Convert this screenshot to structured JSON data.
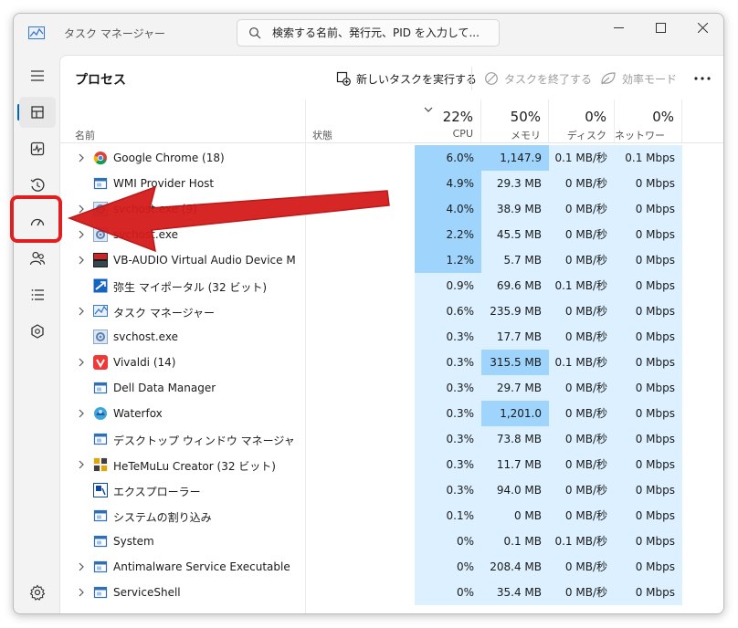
{
  "window": {
    "title": "タスク マネージャー",
    "search_placeholder": "検索する名前、発行元、PID を入力して..."
  },
  "nav": [
    {
      "id": "menu",
      "icon": "hamburger-icon"
    },
    {
      "id": "processes",
      "icon": "processes-icon",
      "active": true
    },
    {
      "id": "performance",
      "icon": "performance-icon"
    },
    {
      "id": "app-history",
      "icon": "history-icon"
    },
    {
      "id": "startup",
      "icon": "startup-speedometer-icon",
      "highlighted": true
    },
    {
      "id": "users",
      "icon": "users-icon"
    },
    {
      "id": "details",
      "icon": "details-list-icon"
    },
    {
      "id": "services",
      "icon": "services-puzzle-icon"
    },
    {
      "id": "settings",
      "icon": "gear-icon"
    }
  ],
  "page": {
    "title": "プロセス",
    "run_new_task": "新しいタスクを実行する",
    "end_task": "タスクを終了する",
    "efficiency_mode": "効率モード"
  },
  "columns": {
    "name": "名前",
    "status": "状態",
    "cpu": {
      "pct": "22%",
      "label": "CPU"
    },
    "memory": {
      "pct": "50%",
      "label": "メモリ"
    },
    "disk": {
      "pct": "0%",
      "label": "ディスク"
    },
    "network": {
      "pct": "0%",
      "label": "ネットワーク"
    }
  },
  "processes": [
    {
      "name": "Google Chrome (18)",
      "expandable": true,
      "icon": "chrome-icon",
      "cpu": "6.0%",
      "memory": "1,147.9 MB",
      "disk": "0.1 MB/秒",
      "network": "0.1 Mbps"
    },
    {
      "name": "WMI Provider Host",
      "expandable": false,
      "icon": "window-icon",
      "cpu": "4.9%",
      "memory": "29.3 MB",
      "disk": "0 MB/秒",
      "network": "0 Mbps"
    },
    {
      "name": "svchost.exe (9)",
      "expandable": true,
      "icon": "gear-app-icon",
      "cpu": "4.0%",
      "memory": "38.9 MB",
      "disk": "0 MB/秒",
      "network": "0 Mbps"
    },
    {
      "name": "svchost.exe",
      "expandable": true,
      "icon": "gear-app-icon",
      "cpu": "2.2%",
      "memory": "45.5 MB",
      "disk": "0 MB/秒",
      "network": "0 Mbps"
    },
    {
      "name": "VB-AUDIO Virtual Audio Device Mixi...",
      "expandable": true,
      "icon": "vb-audio-icon",
      "cpu": "1.2%",
      "memory": "5.7 MB",
      "disk": "0 MB/秒",
      "network": "0 Mbps"
    },
    {
      "name": "弥生 マイポータル (32 ビット)",
      "expandable": false,
      "icon": "yayoi-icon",
      "cpu": "0.9%",
      "memory": "69.6 MB",
      "disk": "0.1 MB/秒",
      "network": "0 Mbps"
    },
    {
      "name": "タスク マネージャー",
      "expandable": true,
      "icon": "task-manager-icon",
      "cpu": "0.6%",
      "memory": "235.9 MB",
      "disk": "0 MB/秒",
      "network": "0 Mbps"
    },
    {
      "name": "svchost.exe",
      "expandable": false,
      "icon": "gear-app-icon",
      "cpu": "0.3%",
      "memory": "17.7 MB",
      "disk": "0 MB/秒",
      "network": "0 Mbps"
    },
    {
      "name": "Vivaldi (14)",
      "expandable": true,
      "icon": "vivaldi-icon",
      "cpu": "0.3%",
      "memory": "315.5 MB",
      "disk": "0.1 MB/秒",
      "network": "0 Mbps"
    },
    {
      "name": "Dell Data Manager",
      "expandable": false,
      "icon": "window-icon",
      "cpu": "0.3%",
      "memory": "29.7 MB",
      "disk": "0 MB/秒",
      "network": "0 Mbps"
    },
    {
      "name": "Waterfox",
      "expandable": true,
      "icon": "waterfox-icon",
      "cpu": "0.3%",
      "memory": "1,201.0 MB",
      "disk": "0 MB/秒",
      "network": "0 Mbps"
    },
    {
      "name": "デスクトップ ウィンドウ マネージャー",
      "expandable": false,
      "icon": "window-icon",
      "cpu": "0.3%",
      "memory": "73.8 MB",
      "disk": "0 MB/秒",
      "network": "0 Mbps"
    },
    {
      "name": "HeTeMuLu Creator (32 ビット)",
      "expandable": true,
      "icon": "hetemulu-icon",
      "cpu": "0.3%",
      "memory": "11.7 MB",
      "disk": "0 MB/秒",
      "network": "0 Mbps"
    },
    {
      "name": "エクスプローラー",
      "expandable": false,
      "icon": "explorer-icon",
      "cpu": "0.3%",
      "memory": "94.0 MB",
      "disk": "0 MB/秒",
      "network": "0 Mbps"
    },
    {
      "name": "システムの割り込み",
      "expandable": false,
      "icon": "window-icon",
      "cpu": "0.1%",
      "memory": "0 MB",
      "disk": "0 MB/秒",
      "network": "0 Mbps"
    },
    {
      "name": "System",
      "expandable": false,
      "icon": "window-icon",
      "cpu": "0%",
      "memory": "0.1 MB",
      "disk": "0.1 MB/秒",
      "network": "0 Mbps"
    },
    {
      "name": "Antimalware Service Executable",
      "expandable": true,
      "icon": "window-icon",
      "cpu": "0%",
      "memory": "208.4 MB",
      "disk": "0 MB/秒",
      "network": "0 Mbps"
    },
    {
      "name": "ServiceShell",
      "expandable": true,
      "icon": "window-icon",
      "cpu": "0%",
      "memory": "35.4 MB",
      "disk": "0 MB/秒",
      "network": "0 Mbps"
    }
  ],
  "colors": {
    "heat_high": "#9fd5fc",
    "heat_low": "#dcf0ff",
    "accent": "#0067c0",
    "annotation_red": "#e02020"
  }
}
